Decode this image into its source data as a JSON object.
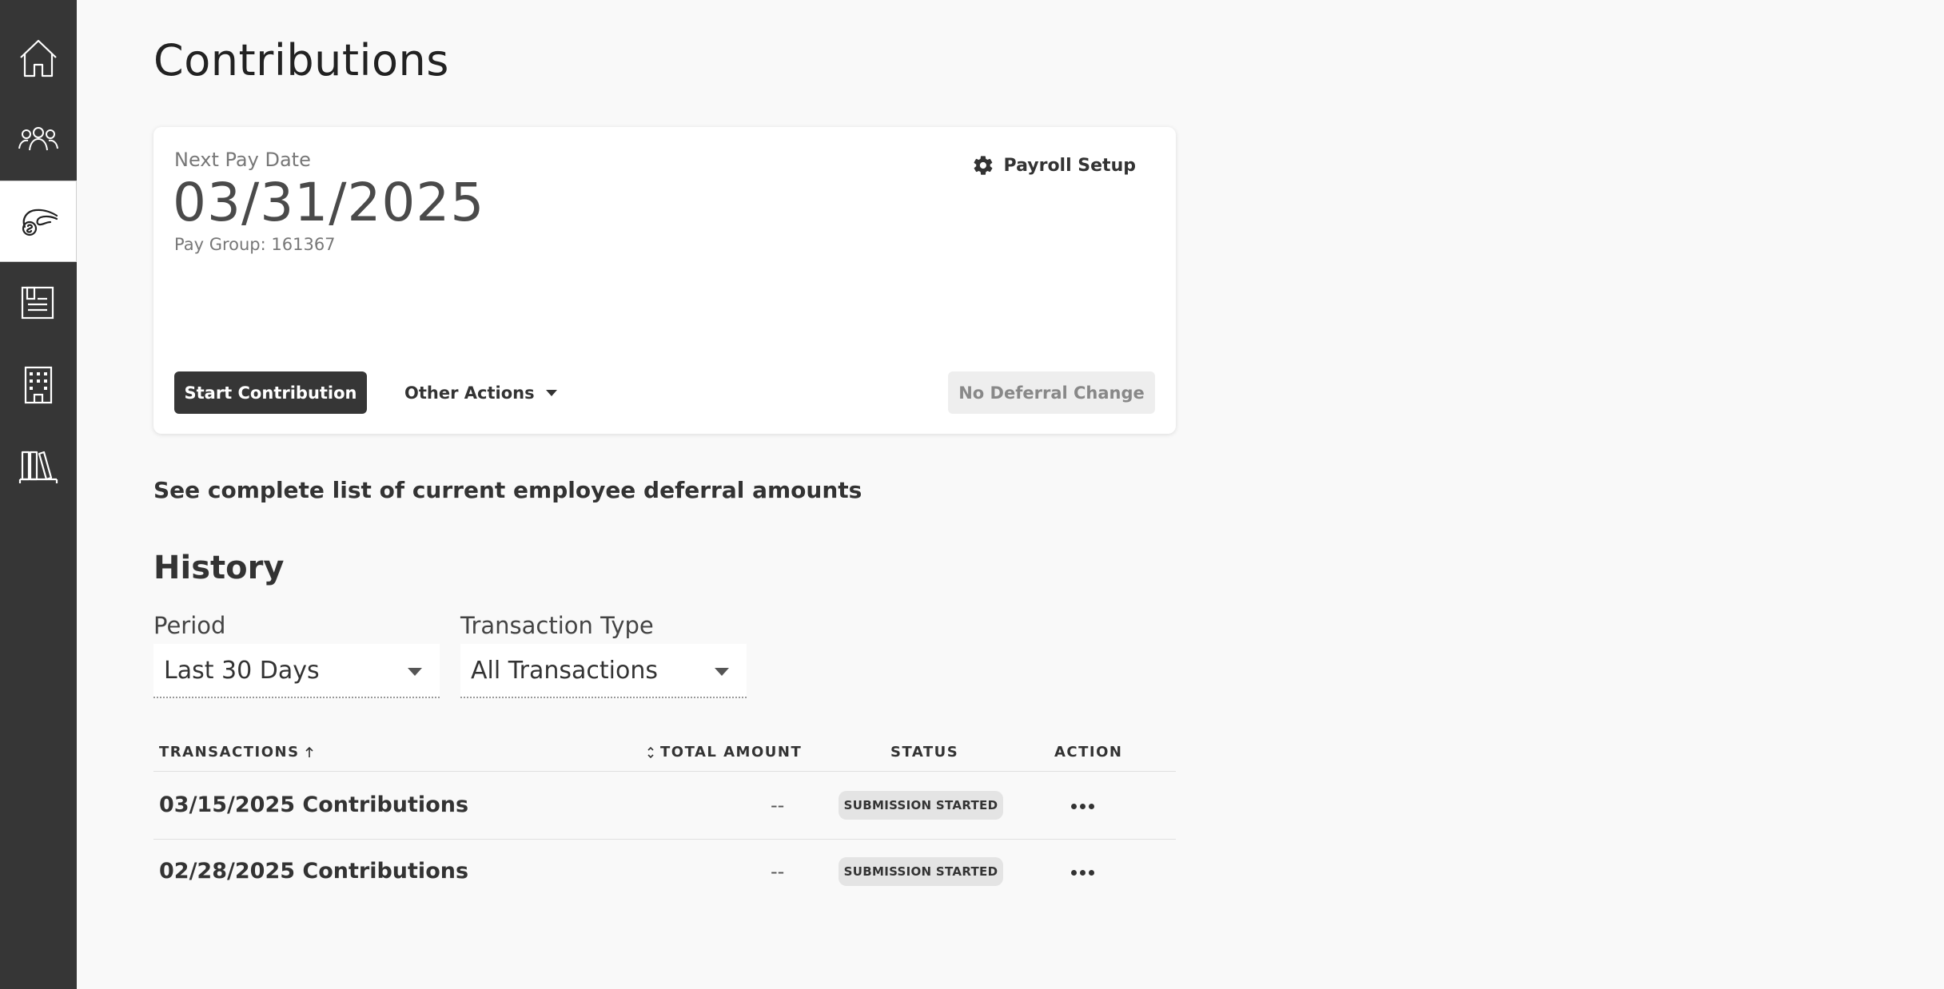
{
  "sidebar": {
    "items": [
      {
        "icon": "home-icon"
      },
      {
        "icon": "people-icon"
      },
      {
        "icon": "hand-coin-icon",
        "active": true
      },
      {
        "icon": "document-icon"
      },
      {
        "icon": "building-icon"
      },
      {
        "icon": "books-icon"
      }
    ]
  },
  "page": {
    "title": "Contributions"
  },
  "card": {
    "next_pay_label": "Next Pay Date",
    "next_pay_date": "03/31/2025",
    "pay_group": "Pay Group: 161367",
    "payroll_setup": "Payroll Setup",
    "start_contribution": "Start Contribution",
    "other_actions": "Other Actions",
    "no_deferral_change": "No Deferral Change"
  },
  "deferral_link": "See complete list of current employee deferral amounts",
  "history": {
    "title": "History",
    "period_label": "Period",
    "period_value": "Last 30 Days",
    "type_label": "Transaction Type",
    "type_value": "All Transactions",
    "columns": {
      "transactions": "TRANSACTIONS",
      "total_amount": "TOTAL AMOUNT",
      "status": "STATUS",
      "action": "ACTION"
    },
    "rows": [
      {
        "name": "03/15/2025 Contributions",
        "amount": "--",
        "status": "SUBMISSION STARTED"
      },
      {
        "name": "02/28/2025 Contributions",
        "amount": "--",
        "status": "SUBMISSION STARTED"
      }
    ]
  }
}
